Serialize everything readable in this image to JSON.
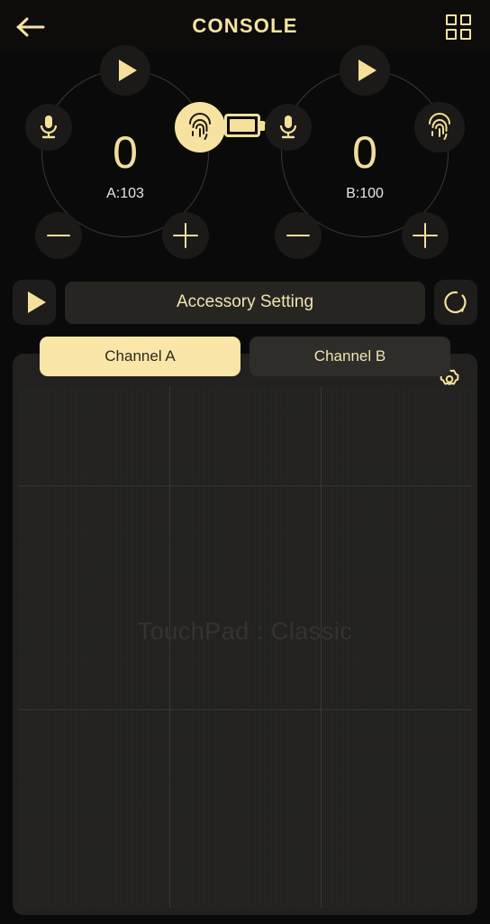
{
  "header": {
    "title": "CONSOLE",
    "back_icon": "arrow-left-icon",
    "grid_icon": "grid-4-icon"
  },
  "status": {
    "battery_icon": "battery-full-icon"
  },
  "channels": [
    {
      "id": "A",
      "value": "0",
      "label": "A:103",
      "play_icon": "play-icon",
      "mic_icon": "microphone-icon",
      "fingerprint_icon": "fingerprint-icon",
      "fingerprint_active": true,
      "minus_icon": "minus-icon",
      "plus_icon": "plus-icon"
    },
    {
      "id": "B",
      "value": "0",
      "label": "B:100",
      "play_icon": "play-icon",
      "mic_icon": "microphone-icon",
      "fingerprint_icon": "fingerprint-icon",
      "fingerprint_active": false,
      "minus_icon": "minus-icon",
      "plus_icon": "plus-icon"
    }
  ],
  "toolbar": {
    "play_icon": "play-icon",
    "accessory_setting_label": "Accessory Setting",
    "refresh_icon": "refresh-circle-icon"
  },
  "tabs": [
    {
      "label": "Channel A",
      "active": true
    },
    {
      "label": "Channel B",
      "active": false
    }
  ],
  "touchpad": {
    "watermark": "TouchPad : Classic",
    "gear_icon": "gear-icon"
  },
  "colors": {
    "accent": "#f7e3a1",
    "accent_strong": "#fae7a8",
    "background": "#0a0a0a",
    "surface": "#262522",
    "pad_surface": "#262524",
    "text_light": "#e6e6e6"
  }
}
